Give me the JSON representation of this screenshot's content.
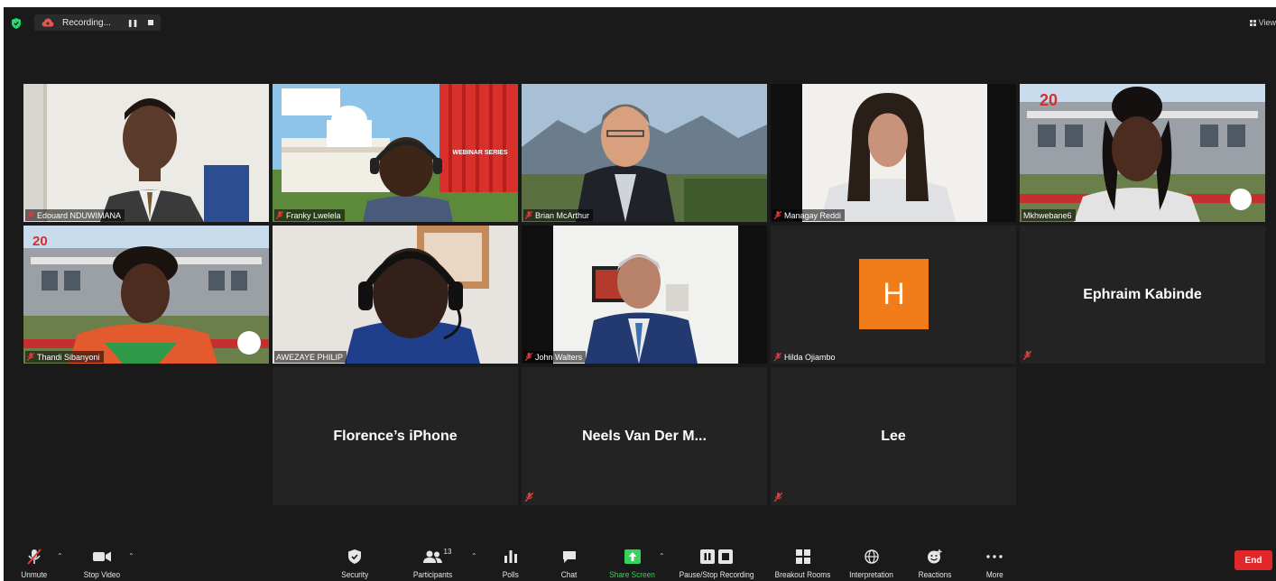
{
  "topbar": {
    "recording_label": "Recording...",
    "view_label": "View"
  },
  "participants": [
    {
      "name": "Edouard NDUWIMANA",
      "muted": true
    },
    {
      "name": "Franky Lwelela",
      "muted": true
    },
    {
      "name": "Brian McArthur",
      "muted": true
    },
    {
      "name": "Managay Reddi",
      "muted": true
    },
    {
      "name": "Mkhwebane6",
      "muted": false,
      "active_speaker": true
    },
    {
      "name": "Thandi Sibanyoni",
      "muted": true
    },
    {
      "name": "AWEZAYE PHILIP",
      "muted": false
    },
    {
      "name": "John Walters",
      "muted": true
    },
    {
      "name": "Hilda Ojiambo",
      "muted": true,
      "avatar_letter": "H"
    },
    {
      "name": "Ephraim Kabinde",
      "muted": true
    },
    {
      "name": "Florence’s iPhone",
      "muted": false
    },
    {
      "name": "Neels Van Der M...",
      "muted": true
    },
    {
      "name": "Lee",
      "muted": true
    }
  ],
  "scenes": {
    "webinar_banner": "WEBINAR SERIES",
    "years_badge": "20"
  },
  "toolbar": {
    "unmute": "Unmute",
    "stop_video": "Stop Video",
    "security": "Security",
    "participants": "Participants",
    "participants_count": "13",
    "polls": "Polls",
    "chat": "Chat",
    "share_screen": "Share Screen",
    "pause_stop_recording": "Pause/Stop Recording",
    "breakout_rooms": "Breakout Rooms",
    "interpretation": "Interpretation",
    "reactions": "Reactions",
    "more": "More",
    "end": "End"
  },
  "colors": {
    "active_speaker_border": "#d5e05a",
    "share_screen_green": "#35d35b",
    "end_red": "#e02828",
    "avatar_orange": "#f07c1a",
    "muted_red": "#e03a3a"
  }
}
